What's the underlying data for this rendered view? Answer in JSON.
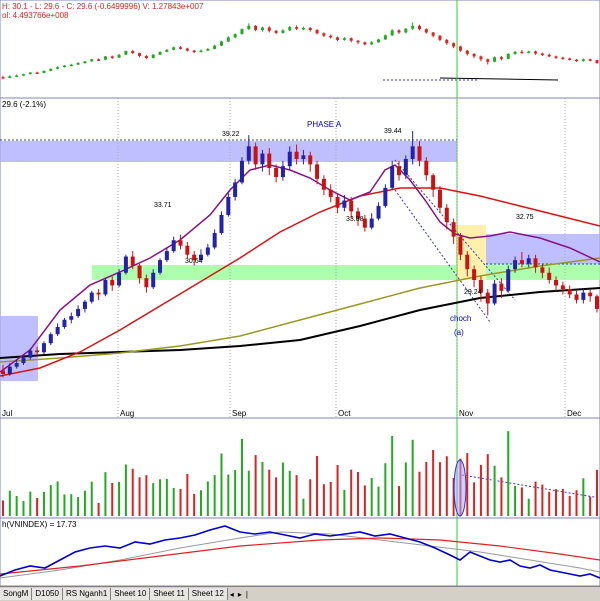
{
  "top_panel": {
    "header_line1": "H: 30.1 - L: 29.6 - C: 29.6 (-0.6499996) V: 1.27843e+007",
    "header_line2": "ol: 4.493766e+008",
    "colors": {
      "up": "#22aa22",
      "down": "#dd2222",
      "header_red": "#dd2222"
    }
  },
  "main_panel": {
    "header": "29.6 (-2.1%)",
    "phase_label": "PHASE A",
    "price_labels": [
      "39.22",
      "39.44",
      "33.71",
      "33.88",
      "30.64",
      "32.75",
      "29.24"
    ],
    "choch_label": "choch",
    "wave_label": "(a)",
    "month_labels": [
      "Jul",
      "Aug",
      "Sep",
      "Oct",
      "Nov",
      "Dec"
    ],
    "colors": {
      "up": "#2222aa",
      "down": "#cc1111",
      "ma_red": "#dd1111",
      "ma_purple": "#881188",
      "ma_olive": "#999922",
      "ma_black": "#000000",
      "zone_blue": "#aaaaff",
      "zone_green": "#99ff99",
      "zone_yellow": "#ffee99"
    }
  },
  "volume_panel": {
    "colors": {
      "up": "#22aa22",
      "down": "#dd2222"
    }
  },
  "rs_panel": {
    "header": "h(VNINDEX) = 17.73",
    "colors": {
      "line": "#0000cc",
      "ma_red": "#dd2222",
      "ma_gray": "#999999"
    }
  },
  "tabs": [
    "SongM",
    "D1050",
    "RS Nganh1",
    "Sheet 10",
    "Sheet 11",
    "Sheet 12",
    "◂",
    "▸",
    "|"
  ],
  "chart_data": {
    "type": "candlestick",
    "title": "",
    "x_months": [
      "Jul",
      "Aug",
      "Sep",
      "Oct",
      "Nov",
      "Dec"
    ],
    "annotations": [
      {
        "label": "39.22",
        "value": 39.22
      },
      {
        "label": "39.44",
        "value": 39.44
      },
      {
        "label": "33.71",
        "value": 33.71
      },
      {
        "label": "33.88",
        "value": 33.88
      },
      {
        "label": "30.64",
        "value": 30.64
      },
      {
        "label": "32.75",
        "value": 32.75
      },
      {
        "label": "29.24",
        "value": 29.24
      }
    ],
    "last": {
      "high": 30.1,
      "low": 29.6,
      "close": 29.6,
      "change": -0.6499996,
      "change_pct": -2.1,
      "volume": 12784300
    },
    "candles": [
      {
        "o": 26.2,
        "c": 26.0,
        "h": 26.5,
        "l": 25.8
      },
      {
        "o": 26.0,
        "c": 26.4,
        "h": 26.6,
        "l": 25.9
      },
      {
        "o": 26.4,
        "c": 26.6,
        "h": 26.8,
        "l": 26.3
      },
      {
        "o": 26.6,
        "c": 26.9,
        "h": 27.0,
        "l": 26.5
      },
      {
        "o": 26.9,
        "c": 27.3,
        "h": 27.4,
        "l": 26.8
      },
      {
        "o": 27.3,
        "c": 27.2,
        "h": 27.5,
        "l": 27.0
      },
      {
        "o": 27.2,
        "c": 27.7,
        "h": 27.8,
        "l": 27.1
      },
      {
        "o": 27.7,
        "c": 28.2,
        "h": 28.3,
        "l": 27.6
      },
      {
        "o": 28.2,
        "c": 28.6,
        "h": 28.8,
        "l": 28.1
      },
      {
        "o": 28.6,
        "c": 29.0,
        "h": 29.1,
        "l": 28.5
      },
      {
        "o": 29.0,
        "c": 29.2,
        "h": 29.4,
        "l": 28.8
      },
      {
        "o": 29.2,
        "c": 29.6,
        "h": 29.8,
        "l": 29.1
      },
      {
        "o": 29.6,
        "c": 30.0,
        "h": 30.1,
        "l": 29.4
      },
      {
        "o": 30.0,
        "c": 30.5,
        "h": 30.6,
        "l": 29.9
      },
      {
        "o": 30.5,
        "c": 30.4,
        "h": 30.7,
        "l": 30.1
      },
      {
        "o": 30.4,
        "c": 31.2,
        "h": 31.3,
        "l": 30.3
      },
      {
        "o": 31.2,
        "c": 30.9,
        "h": 31.4,
        "l": 30.6
      },
      {
        "o": 30.9,
        "c": 31.6,
        "h": 31.8,
        "l": 30.8
      },
      {
        "o": 31.6,
        "c": 32.5,
        "h": 32.6,
        "l": 31.5
      },
      {
        "o": 32.5,
        "c": 32.0,
        "h": 32.8,
        "l": 31.8
      },
      {
        "o": 32.0,
        "c": 31.3,
        "h": 32.1,
        "l": 31.0
      },
      {
        "o": 31.3,
        "c": 30.8,
        "h": 31.5,
        "l": 30.5
      },
      {
        "o": 30.8,
        "c": 31.6,
        "h": 31.8,
        "l": 30.7
      },
      {
        "o": 31.6,
        "c": 32.3,
        "h": 32.4,
        "l": 31.5
      },
      {
        "o": 32.3,
        "c": 32.8,
        "h": 33.0,
        "l": 32.2
      },
      {
        "o": 32.8,
        "c": 33.4,
        "h": 33.6,
        "l": 32.7
      },
      {
        "o": 33.4,
        "c": 33.1,
        "h": 33.71,
        "l": 32.9
      },
      {
        "o": 33.1,
        "c": 32.6,
        "h": 33.3,
        "l": 32.4
      },
      {
        "o": 32.6,
        "c": 32.3,
        "h": 32.8,
        "l": 32.0
      },
      {
        "o": 32.3,
        "c": 32.6,
        "h": 32.9,
        "l": 32.2
      },
      {
        "o": 32.6,
        "c": 33.0,
        "h": 33.2,
        "l": 32.5
      },
      {
        "o": 33.0,
        "c": 33.8,
        "h": 34.0,
        "l": 32.9
      },
      {
        "o": 33.8,
        "c": 34.8,
        "h": 35.0,
        "l": 33.7
      },
      {
        "o": 34.8,
        "c": 35.8,
        "h": 36.1,
        "l": 34.7
      },
      {
        "o": 35.8,
        "c": 36.6,
        "h": 36.8,
        "l": 35.6
      },
      {
        "o": 36.6,
        "c": 37.8,
        "h": 38.0,
        "l": 36.5
      },
      {
        "o": 37.8,
        "c": 38.6,
        "h": 39.22,
        "l": 37.6
      },
      {
        "o": 38.6,
        "c": 37.6,
        "h": 38.8,
        "l": 37.3
      },
      {
        "o": 37.6,
        "c": 38.2,
        "h": 38.4,
        "l": 37.2
      },
      {
        "o": 38.2,
        "c": 37.4,
        "h": 38.5,
        "l": 37.0
      },
      {
        "o": 37.4,
        "c": 36.9,
        "h": 37.6,
        "l": 36.6
      },
      {
        "o": 36.9,
        "c": 37.5,
        "h": 37.8,
        "l": 36.7
      },
      {
        "o": 37.5,
        "c": 38.3,
        "h": 38.6,
        "l": 37.3
      },
      {
        "o": 38.3,
        "c": 37.9,
        "h": 38.7,
        "l": 37.6
      },
      {
        "o": 37.9,
        "c": 38.1,
        "h": 38.4,
        "l": 37.6
      },
      {
        "o": 38.1,
        "c": 37.6,
        "h": 38.3,
        "l": 37.2
      },
      {
        "o": 37.6,
        "c": 36.8,
        "h": 37.8,
        "l": 36.5
      },
      {
        "o": 36.8,
        "c": 36.2,
        "h": 37.0,
        "l": 35.9
      },
      {
        "o": 36.2,
        "c": 35.8,
        "h": 36.5,
        "l": 35.5
      },
      {
        "o": 35.8,
        "c": 35.2,
        "h": 36.0,
        "l": 34.9
      },
      {
        "o": 35.2,
        "c": 35.6,
        "h": 35.9,
        "l": 35.0
      },
      {
        "o": 35.6,
        "c": 35.0,
        "h": 35.8,
        "l": 34.6
      },
      {
        "o": 35.0,
        "c": 34.6,
        "h": 35.2,
        "l": 34.2
      },
      {
        "o": 34.6,
        "c": 34.1,
        "h": 34.8,
        "l": 33.88
      },
      {
        "o": 34.1,
        "c": 34.6,
        "h": 34.9,
        "l": 34.0
      },
      {
        "o": 34.6,
        "c": 35.3,
        "h": 35.5,
        "l": 34.5
      },
      {
        "o": 35.3,
        "c": 36.3,
        "h": 36.5,
        "l": 35.2
      },
      {
        "o": 36.3,
        "c": 37.5,
        "h": 37.8,
        "l": 36.2
      },
      {
        "o": 37.5,
        "c": 37.0,
        "h": 37.8,
        "l": 36.7
      },
      {
        "o": 37.0,
        "c": 37.9,
        "h": 38.1,
        "l": 36.8
      },
      {
        "o": 37.9,
        "c": 38.6,
        "h": 39.44,
        "l": 37.6
      },
      {
        "o": 38.6,
        "c": 37.8,
        "h": 38.9,
        "l": 37.5
      },
      {
        "o": 37.8,
        "c": 37.0,
        "h": 38.0,
        "l": 36.7
      },
      {
        "o": 37.0,
        "c": 36.2,
        "h": 37.1,
        "l": 35.8
      },
      {
        "o": 36.2,
        "c": 35.2,
        "h": 36.4,
        "l": 34.9
      },
      {
        "o": 35.2,
        "c": 34.4,
        "h": 35.4,
        "l": 34.0
      },
      {
        "o": 34.4,
        "c": 33.6,
        "h": 34.6,
        "l": 33.2
      },
      {
        "o": 33.6,
        "c": 32.6,
        "h": 33.8,
        "l": 32.3
      },
      {
        "o": 32.6,
        "c": 31.8,
        "h": 32.8,
        "l": 31.4
      },
      {
        "o": 31.8,
        "c": 31.2,
        "h": 32.0,
        "l": 30.8
      },
      {
        "o": 31.2,
        "c": 30.5,
        "h": 31.4,
        "l": 30.0
      },
      {
        "o": 30.5,
        "c": 29.9,
        "h": 30.7,
        "l": 29.24
      },
      {
        "o": 29.9,
        "c": 31.0,
        "h": 31.2,
        "l": 29.8
      },
      {
        "o": 31.0,
        "c": 30.6,
        "h": 31.3,
        "l": 30.2
      },
      {
        "o": 30.6,
        "c": 31.8,
        "h": 32.0,
        "l": 30.5
      },
      {
        "o": 31.8,
        "c": 32.3,
        "h": 32.5,
        "l": 31.6
      },
      {
        "o": 32.3,
        "c": 32.1,
        "h": 32.75,
        "l": 31.9
      },
      {
        "o": 32.1,
        "c": 32.4,
        "h": 32.6,
        "l": 31.9
      },
      {
        "o": 32.4,
        "c": 31.9,
        "h": 32.6,
        "l": 31.6
      },
      {
        "o": 31.9,
        "c": 31.6,
        "h": 32.1,
        "l": 31.3
      },
      {
        "o": 31.6,
        "c": 31.2,
        "h": 31.9,
        "l": 31.0
      },
      {
        "o": 31.2,
        "c": 30.9,
        "h": 31.4,
        "l": 30.6
      },
      {
        "o": 30.9,
        "c": 30.7,
        "h": 31.1,
        "l": 30.4
      },
      {
        "o": 30.7,
        "c": 30.4,
        "h": 30.9,
        "l": 30.2
      },
      {
        "o": 30.4,
        "c": 30.1,
        "h": 30.6,
        "l": 29.9
      },
      {
        "o": 30.1,
        "c": 30.5,
        "h": 30.7,
        "l": 29.9
      },
      {
        "o": 30.5,
        "c": 30.3,
        "h": 30.7,
        "l": 30.0
      },
      {
        "o": 30.3,
        "c": 29.6,
        "h": 30.4,
        "l": 29.4
      }
    ]
  }
}
